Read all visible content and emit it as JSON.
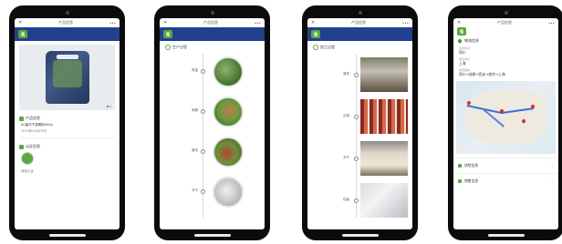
{
  "phones": {
    "p1": {
      "title": "产品信息",
      "status_left": "✕",
      "status_right": "•••",
      "brand": "",
      "header_right": "",
      "section_product": "产品信息",
      "product_name": "AC级冻干蓝莓粉500g",
      "product_date": "2019年03月05日",
      "section_cert": "认证信息",
      "cert_label": "绿色认证"
    },
    "p2": {
      "title": "产品信息",
      "status_left": "✕",
      "status_right": "•••",
      "brand": "",
      "header_right": "",
      "timeline_title": "生产过程",
      "items": [
        "育苗",
        "采摘",
        "清洗",
        "冻干"
      ]
    },
    "p3": {
      "title": "产品信息",
      "status_left": "✕",
      "status_right": "•••",
      "brand": "",
      "header_right": "",
      "timeline_title": "加工过程",
      "items": [
        "清洗",
        "分选",
        "冻干",
        "包装"
      ]
    },
    "p4": {
      "title": "产品信息",
      "status_left": "✕",
      "status_right": "•••",
      "brand": "",
      "header_right": "",
      "location_title": "物流信息",
      "k1": "出发地点",
      "v1": "四川",
      "k2": "到达地点",
      "v2": "上海",
      "k3": "物流路线",
      "v3": "四川→成都→西安→南京→上海",
      "map_footer": "",
      "row1": "质检信息",
      "row2": "销售信息"
    }
  },
  "colors": {
    "header_blue": "#23408f",
    "accent_green": "#5aa845",
    "route_blue": "#3a6fd0",
    "marker_red": "#d9302a"
  }
}
